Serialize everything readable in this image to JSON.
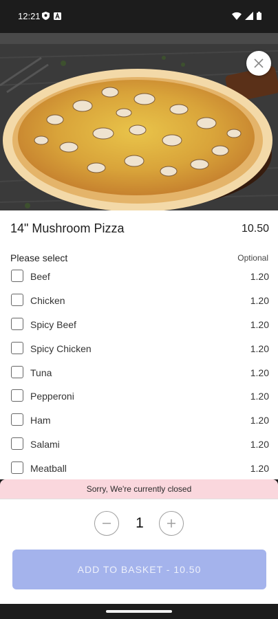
{
  "status_bar": {
    "time": "12:21",
    "left_icons": [
      "shield-icon",
      "a-box-icon"
    ],
    "right_icons": [
      "wifi-icon",
      "signal-icon",
      "battery-icon"
    ]
  },
  "hero": {
    "image": "mushroom-pizza-photo"
  },
  "item": {
    "title": "14\" Mushroom Pizza",
    "price": "10.50"
  },
  "options_section": {
    "label": "Please select",
    "optional_label": "Optional",
    "items": [
      {
        "name": "Beef",
        "price": "1.20"
      },
      {
        "name": "Chicken",
        "price": "1.20"
      },
      {
        "name": "Spicy Beef",
        "price": "1.20"
      },
      {
        "name": "Spicy Chicken",
        "price": "1.20"
      },
      {
        "name": "Tuna",
        "price": "1.20"
      },
      {
        "name": "Pepperoni",
        "price": "1.20"
      },
      {
        "name": "Ham",
        "price": "1.20"
      },
      {
        "name": "Salami",
        "price": "1.20"
      },
      {
        "name": "Meatball",
        "price": "1.20"
      }
    ]
  },
  "banner": {
    "text": "Sorry, We're currently closed"
  },
  "quantity": {
    "value": "1"
  },
  "add_to_basket": {
    "label": "ADD TO BASKET - 10.50"
  },
  "colors": {
    "button_disabled": "#a4b3ec",
    "banner_bg": "#fad7dd"
  }
}
